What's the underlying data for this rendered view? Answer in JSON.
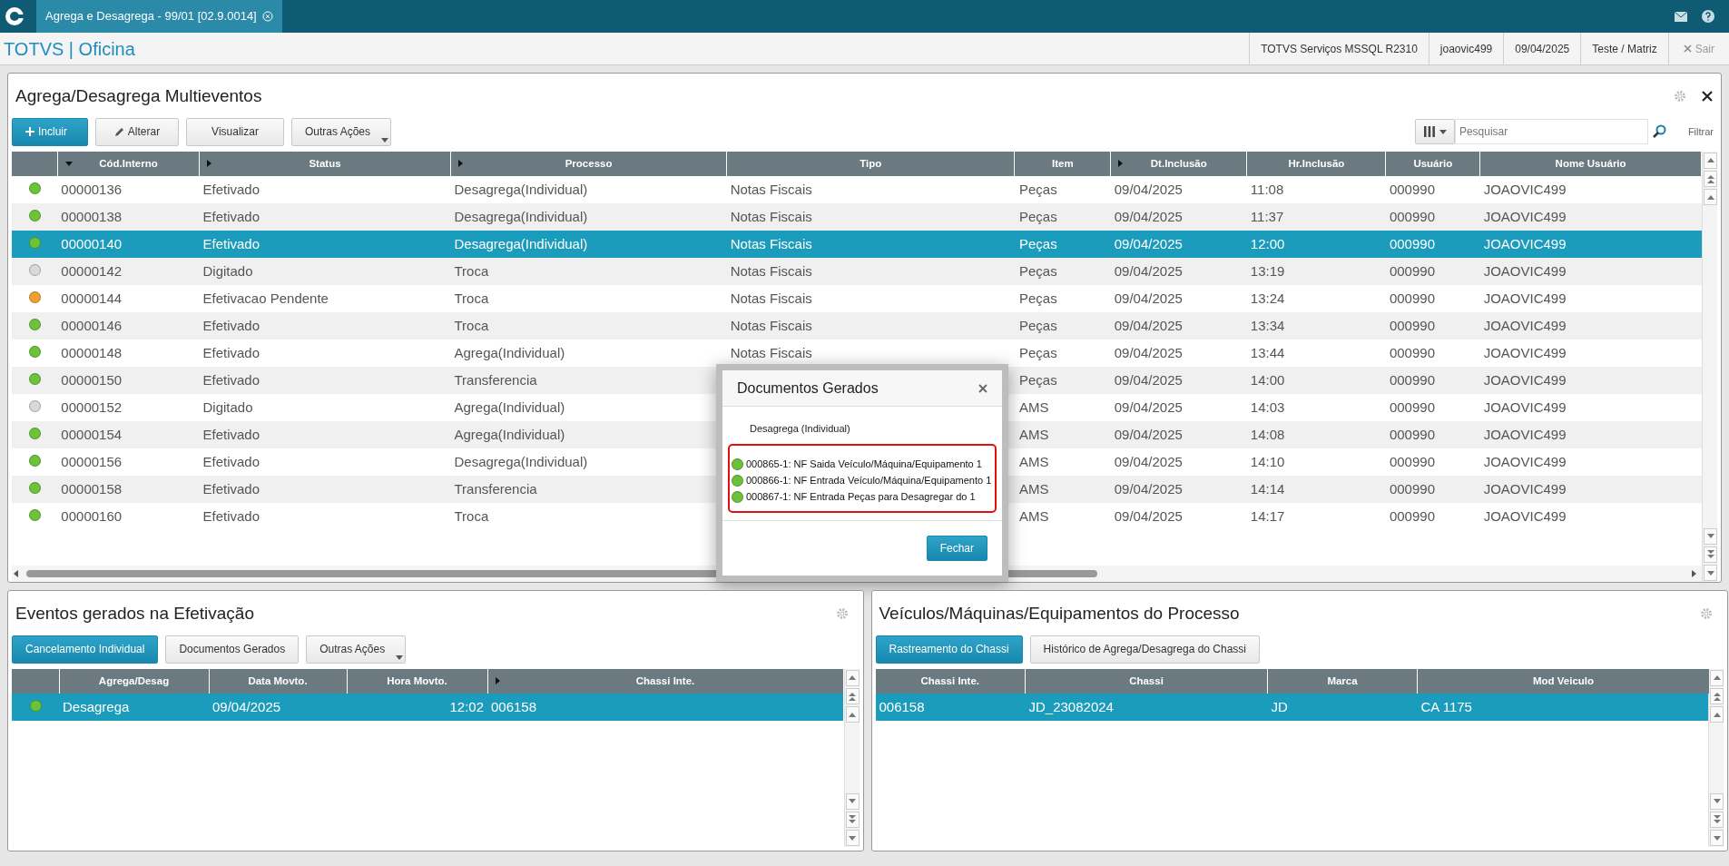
{
  "window": {
    "tab": "Agrega e Desagrega - 99/01 [02.9.0014]"
  },
  "header": {
    "app_title": "TOTVS | Oficina",
    "info": [
      "TOTVS Serviços MSSQL R2310",
      "joaovic499",
      "09/04/2025",
      "Teste / Matriz"
    ],
    "exit": "Sair"
  },
  "main_panel": {
    "title": "Agrega/Desagrega Multieventos",
    "buttons": [
      {
        "label": "Incluir",
        "kind": "primary-plus"
      },
      {
        "label": "Alterar",
        "kind": "pencil"
      },
      {
        "label": "Visualizar",
        "kind": "plain"
      },
      {
        "label": "Outras Ações",
        "kind": "menu"
      }
    ],
    "search": {
      "placeholder": "Pesquisar"
    },
    "filter": "Filtrar",
    "table": {
      "columns": [
        {
          "label": "Cód.Interno",
          "kind": "sorted"
        },
        {
          "label": "Status",
          "kind": "expandable"
        },
        {
          "label": "Processo",
          "kind": "expandable"
        },
        {
          "label": "Tipo",
          "kind": "plain"
        },
        {
          "label": "Item",
          "kind": "plain"
        },
        {
          "label": "Dt.Inclusão",
          "kind": "expandable"
        },
        {
          "label": "Hr.Inclusão",
          "kind": "plain"
        },
        {
          "label": "Usuário",
          "kind": "plain"
        },
        {
          "label": "Nome Usuário",
          "kind": "plain"
        }
      ],
      "rows": [
        {
          "color": "#6cc33a",
          "selected": false,
          "cells": [
            "00000136",
            "Efetivado",
            "Desagrega(Individual)",
            "Notas Fiscais",
            "Peças",
            "09/04/2025",
            "11:08",
            "000990",
            "JOAOVIC499"
          ]
        },
        {
          "color": "#6cc33a",
          "selected": false,
          "cells": [
            "00000138",
            "Efetivado",
            "Desagrega(Individual)",
            "Notas Fiscais",
            "Peças",
            "09/04/2025",
            "11:37",
            "000990",
            "JOAOVIC499"
          ]
        },
        {
          "color": "#6cc33a",
          "selected": true,
          "cells": [
            "00000140",
            "Efetivado",
            "Desagrega(Individual)",
            "Notas Fiscais",
            "Peças",
            "09/04/2025",
            "12:00",
            "000990",
            "JOAOVIC499"
          ]
        },
        {
          "color": "#d9d9d9",
          "selected": false,
          "cells": [
            "00000142",
            "Digitado",
            "Troca",
            "Notas Fiscais",
            "Peças",
            "09/04/2025",
            "13:19",
            "000990",
            "JOAOVIC499"
          ]
        },
        {
          "color": "#f0a030",
          "selected": false,
          "cells": [
            "00000144",
            "Efetivacao Pendente",
            "Troca",
            "Notas Fiscais",
            "Peças",
            "09/04/2025",
            "13:24",
            "000990",
            "JOAOVIC499"
          ]
        },
        {
          "color": "#6cc33a",
          "selected": false,
          "cells": [
            "00000146",
            "Efetivado",
            "Troca",
            "Notas Fiscais",
            "Peças",
            "09/04/2025",
            "13:34",
            "000990",
            "JOAOVIC499"
          ]
        },
        {
          "color": "#6cc33a",
          "selected": false,
          "cells": [
            "00000148",
            "Efetivado",
            "Agrega(Individual)",
            "Notas Fiscais",
            "Peças",
            "09/04/2025",
            "13:44",
            "000990",
            "JOAOVIC499"
          ]
        },
        {
          "color": "#6cc33a",
          "selected": false,
          "cells": [
            "00000150",
            "Efetivado",
            "Transferencia",
            null,
            "Peças",
            "09/04/2025",
            "14:00",
            "000990",
            "JOAOVIC499"
          ]
        },
        {
          "color": "#d9d9d9",
          "selected": false,
          "cells": [
            "00000152",
            "Digitado",
            "Agrega(Individual)",
            null,
            "AMS",
            "09/04/2025",
            "14:03",
            "000990",
            "JOAOVIC499"
          ]
        },
        {
          "color": "#6cc33a",
          "selected": false,
          "cells": [
            "00000154",
            "Efetivado",
            "Agrega(Individual)",
            null,
            "AMS",
            "09/04/2025",
            "14:08",
            "000990",
            "JOAOVIC499"
          ]
        },
        {
          "color": "#6cc33a",
          "selected": false,
          "cells": [
            "00000156",
            "Efetivado",
            "Desagrega(Individual)",
            null,
            "AMS",
            "09/04/2025",
            "14:10",
            "000990",
            "JOAOVIC499"
          ]
        },
        {
          "color": "#6cc33a",
          "selected": false,
          "cells": [
            "00000158",
            "Efetivado",
            "Transferencia",
            null,
            "AMS",
            "09/04/2025",
            "14:14",
            "000990",
            "JOAOVIC499"
          ]
        },
        {
          "color": "#6cc33a",
          "selected": false,
          "cells": [
            "00000160",
            "Efetivado",
            "Troca",
            null,
            "AMS",
            "09/04/2025",
            "14:17",
            "000990",
            "JOAOVIC499"
          ]
        }
      ]
    }
  },
  "dialog": {
    "title": "Documentos Gerados",
    "subtitle": "Desagrega (Individual)",
    "documents": [
      {
        "color": "#6cc33a",
        "text": "000865-1: NF Saida Veículo/Máquina/Equipamento 1"
      },
      {
        "color": "#6cc33a",
        "text": "000866-1: NF Entrada Veículo/Máquina/Equipamento 1"
      },
      {
        "color": "#6cc33a",
        "text": "000867-1: NF Entrada Peças para Desagregar do 1"
      }
    ],
    "button": "Fechar"
  },
  "events_panel": {
    "title": "Eventos gerados na Efetivação",
    "buttons": [
      {
        "label": "Cancelamento Individual",
        "kind": "primary"
      },
      {
        "label": "Documentos Gerados",
        "kind": "plain"
      },
      {
        "label": "Outras Ações",
        "kind": "menu"
      }
    ],
    "table": {
      "columns": [
        {
          "label": "Agrega/Desag",
          "kind": "plain"
        },
        {
          "label": "Data Movto.",
          "kind": "plain"
        },
        {
          "label": "Hora Movto.",
          "kind": "plain"
        },
        {
          "label": "Chassi Inte.",
          "kind": "expandable"
        }
      ],
      "rows": [
        {
          "color": "#6cc33a",
          "selected": true,
          "cells": [
            "Desagrega",
            "09/04/2025",
            "12:02",
            "006158"
          ]
        }
      ]
    }
  },
  "vehicles_panel": {
    "title": "Veículos/Máquinas/Equipamentos do Processo",
    "buttons": [
      {
        "label": "Rastreamento do Chassi",
        "kind": "primary"
      },
      {
        "label": "Histórico de Agrega/Desagrega do Chassi",
        "kind": "plain"
      }
    ],
    "table": {
      "columns": [
        {
          "label": "Chassi Inte."
        },
        {
          "label": "Chassi"
        },
        {
          "label": "Marca"
        },
        {
          "label": "Mod Veiculo"
        }
      ],
      "rows": [
        {
          "selected": true,
          "cells": [
            "006158",
            "JD_23082024",
            "JD",
            "CA 1175"
          ]
        }
      ]
    }
  }
}
